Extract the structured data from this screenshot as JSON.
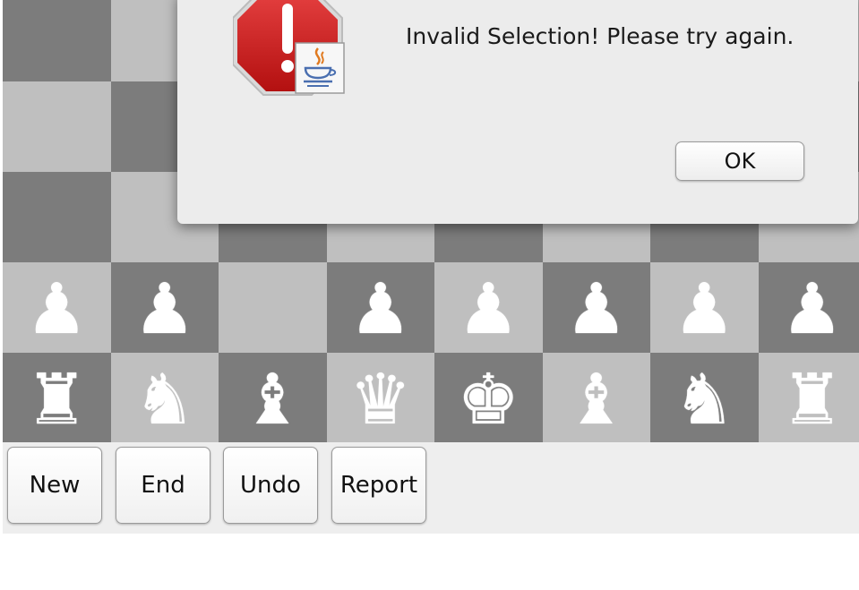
{
  "board": {
    "rows": [
      [
        null,
        null,
        null,
        null,
        null,
        null,
        null,
        null
      ],
      [
        null,
        null,
        null,
        null,
        null,
        null,
        null,
        null
      ],
      [
        null,
        null,
        null,
        null,
        null,
        null,
        null,
        null
      ],
      [
        "pawn",
        "pawn",
        null,
        "pawn",
        "pawn",
        "pawn",
        "pawn",
        "pawn"
      ],
      [
        "rook",
        "knight",
        "bishop",
        "queen",
        "king",
        "bishop",
        "knight",
        "rook"
      ]
    ],
    "piece_color": "white",
    "colors": {
      "light": "#bfbfbf",
      "dark": "#7c7c7c",
      "piece": "#ffffff"
    }
  },
  "buttons": {
    "new_label": "New",
    "end_label": "End",
    "undo_label": "Undo",
    "report_label": "Report"
  },
  "dialog": {
    "message": "Invalid Selection! Please try again.",
    "ok_label": "OK",
    "icon": "error-stop-java-icon",
    "colors": {
      "stop_sign": "#d42020",
      "background": "#ececec"
    }
  }
}
